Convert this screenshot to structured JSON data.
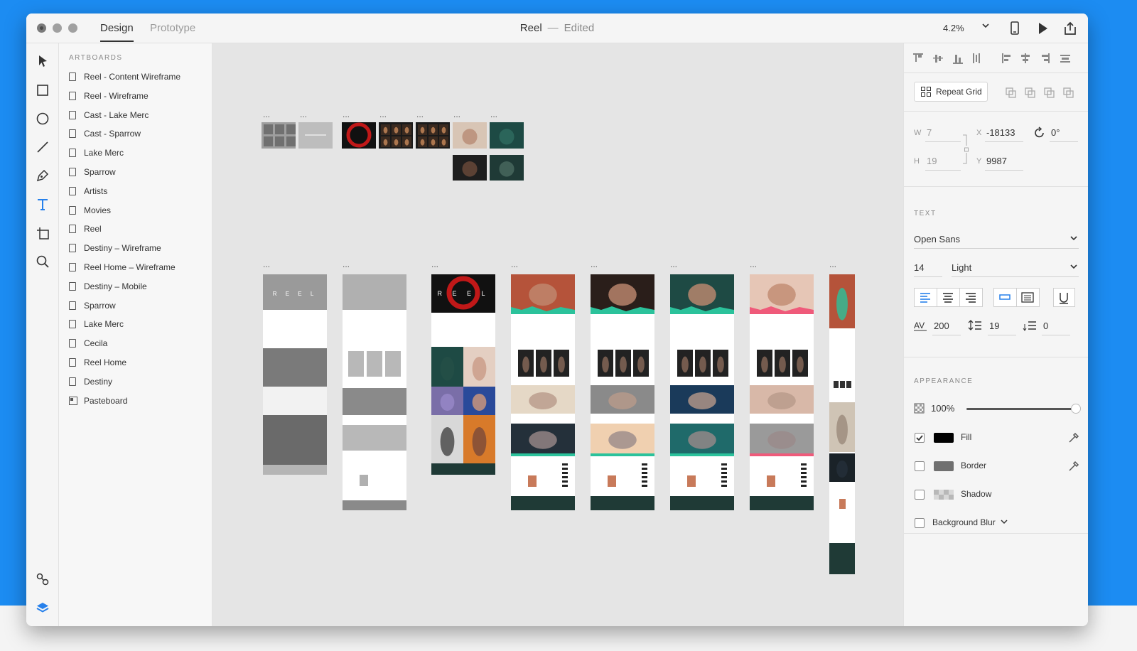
{
  "titlebar": {
    "tabs": [
      "Design",
      "Prototype"
    ],
    "doc_name": "Reel",
    "separator": "—",
    "doc_status": "Edited",
    "zoom": "4.2%"
  },
  "tools": [
    "select-tool",
    "rectangle-tool",
    "ellipse-tool",
    "line-tool",
    "pen-tool",
    "text-tool",
    "artboard-tool",
    "zoom-tool",
    "assets-icon",
    "layers-icon"
  ],
  "layers": {
    "heading": "ARTBOARDS",
    "items": [
      "Reel - Content Wireframe",
      "Reel - Wireframe",
      "Cast - Lake Merc",
      "Cast - Sparrow",
      "Lake Merc",
      "Sparrow",
      "Artists",
      "Movies",
      "Reel",
      "Destiny – Wireframe",
      "Reel Home – Wireframe",
      "Destiny – Mobile",
      "Sparrow",
      "Lake Merc",
      "Cecila",
      "Reel Home",
      "Destiny",
      "Pasteboard"
    ]
  },
  "canvas": {
    "artboard_menu": "...",
    "reel_logo": "R E E L"
  },
  "props": {
    "repeat_grid": "Repeat Grid",
    "w_label": "W",
    "w_value": "7",
    "h_label": "H",
    "h_value": "19",
    "x_label": "X",
    "x_value": "-18133",
    "y_label": "Y",
    "y_value": "9987",
    "rotation": "0°",
    "text_heading": "TEXT",
    "font_family": "Open Sans",
    "font_size": "14",
    "font_weight": "Light",
    "char_spacing": "200",
    "line_spacing": "19",
    "para_spacing": "0",
    "appearance_heading": "APPEARANCE",
    "opacity": "100%",
    "opacity_fraction": 1.0,
    "fill_label": "Fill",
    "fill_color": "#000000",
    "fill_checked": true,
    "border_label": "Border",
    "border_color": "#707070",
    "shadow_label": "Shadow",
    "bg_blur_label": "Background Blur"
  },
  "colors": {
    "accent_blue": "#2680eb",
    "desktop_blue": "#1c8cf2",
    "teal": "#2bc29b",
    "pink": "#ef5a7a",
    "red": "#c01818"
  }
}
